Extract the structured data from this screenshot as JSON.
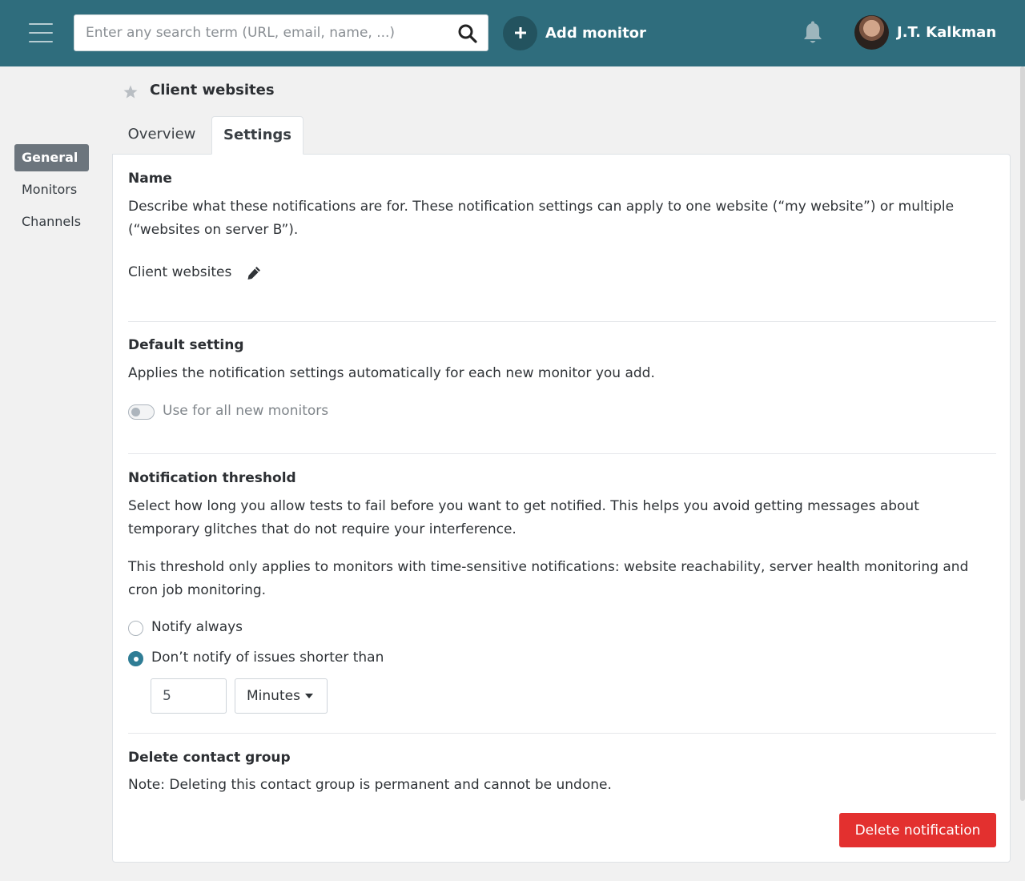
{
  "header": {
    "search_placeholder": "Enter any search term (URL, email, name, ...)",
    "add_monitor_label": "Add monitor",
    "user_name": "J.T. Kalkman"
  },
  "sidebar": {
    "items": [
      {
        "label": "General",
        "active": true
      },
      {
        "label": "Monitors",
        "active": false
      },
      {
        "label": "Channels",
        "active": false
      }
    ]
  },
  "page": {
    "title": "Client websites",
    "tabs": [
      {
        "label": "Overview",
        "active": false
      },
      {
        "label": "Settings",
        "active": true
      }
    ]
  },
  "sections": {
    "name": {
      "title": "Name",
      "description": "Describe what these notifications are for. These notification settings can apply to one website (“my website”) or multiple (“websites on server B”).",
      "value": "Client websites"
    },
    "default_setting": {
      "title": "Default setting",
      "description": "Applies the notification settings automatically for each new monitor you add.",
      "toggle_label": "Use for all new monitors",
      "toggle_on": false
    },
    "threshold": {
      "title": "Notification threshold",
      "description1": "Select how long you allow tests to fail before you want to get notified. This helps you avoid getting messages about temporary glitches that do not require your interference.",
      "description2": "This threshold only applies to monitors with time-sensitive notifications: website reachability, server health monitoring and cron job monitoring.",
      "option_always": "Notify always",
      "option_delay": "Don’t notify of issues shorter than",
      "selected_option": "delay",
      "delay_value": "5",
      "delay_unit": "Minutes"
    },
    "delete": {
      "title": "Delete contact group",
      "description": "Note: Deleting this contact group is permanent and cannot be undone.",
      "button_label": "Delete notification"
    }
  },
  "colors": {
    "header_bg": "#2f6d7d",
    "accent": "#2f7d95",
    "danger": "#e3302f",
    "sidebar_active": "#6c757d"
  }
}
